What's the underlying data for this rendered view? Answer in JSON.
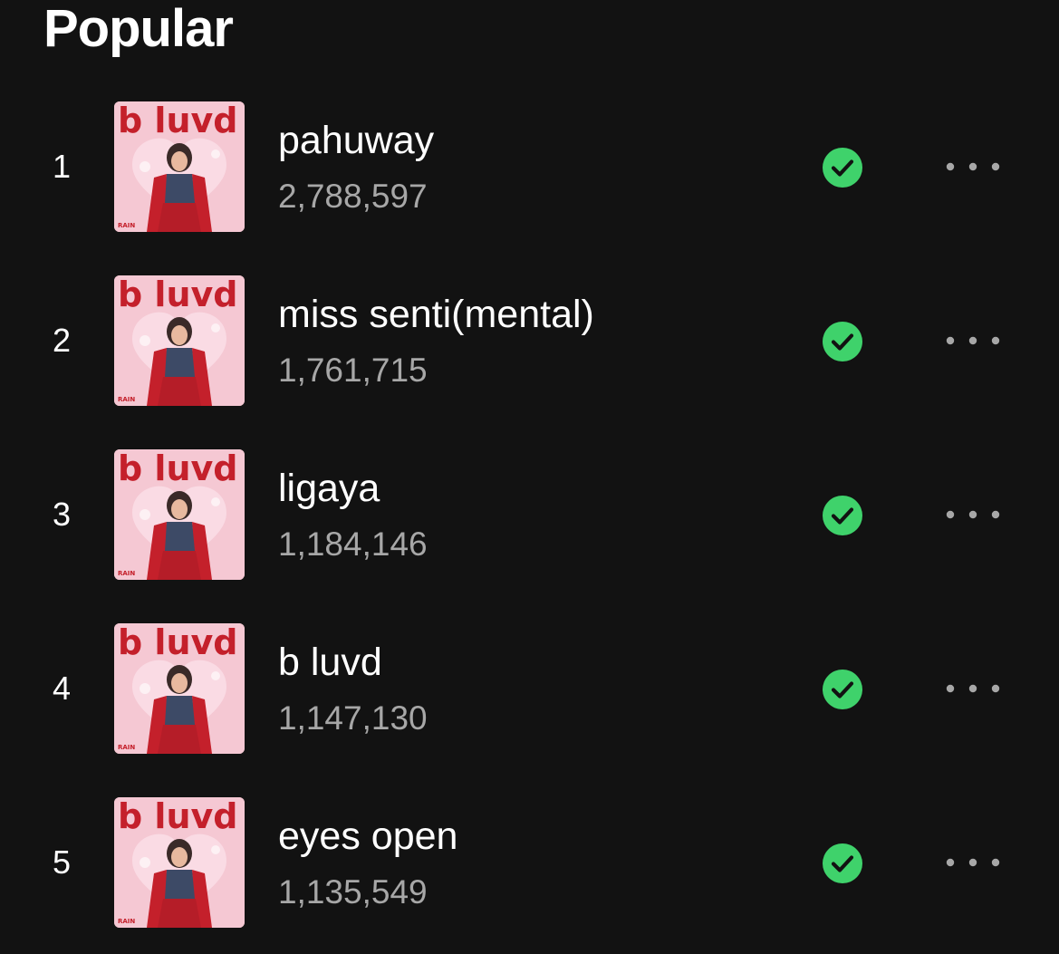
{
  "section": {
    "title": "Popular"
  },
  "tracks": [
    {
      "number": "1",
      "title": "pahuway",
      "plays": "2,788,597",
      "cover_text": "b luvd",
      "cover_artist": "RAIN"
    },
    {
      "number": "2",
      "title": "miss senti(mental)",
      "plays": "1,761,715",
      "cover_text": "b luvd",
      "cover_artist": "RAIN"
    },
    {
      "number": "3",
      "title": "ligaya",
      "plays": "1,184,146",
      "cover_text": "b luvd",
      "cover_artist": "RAIN"
    },
    {
      "number": "4",
      "title": "b luvd",
      "plays": "1,147,130",
      "cover_text": "b luvd",
      "cover_artist": "RAIN"
    },
    {
      "number": "5",
      "title": "eyes open",
      "plays": "1,135,549",
      "cover_text": "b luvd",
      "cover_artist": "RAIN"
    }
  ],
  "icons": {
    "saved": "check-circle-icon",
    "more": "more-options-icon"
  },
  "colors": {
    "background": "#121212",
    "saved_green": "#3fd26b",
    "secondary_text": "#a7a7a7",
    "cover_pink": "#f3c3cf",
    "cover_red": "#c4202b"
  }
}
